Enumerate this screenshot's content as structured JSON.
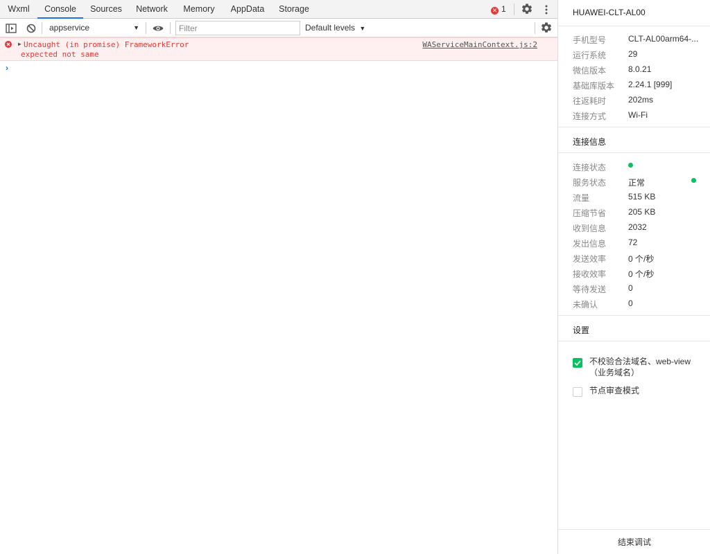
{
  "tabs": [
    {
      "label": "Wxml"
    },
    {
      "label": "Console"
    },
    {
      "label": "Sources"
    },
    {
      "label": "Network"
    },
    {
      "label": "Memory"
    },
    {
      "label": "AppData"
    },
    {
      "label": "Storage"
    }
  ],
  "active_tab": "Console",
  "error_count": "1",
  "console_toolbar": {
    "context": "appservice",
    "filter_placeholder": "Filter",
    "levels": "Default levels"
  },
  "messages": [
    {
      "level": "error",
      "line1": "Uncaught (in promise) FrameworkError",
      "line2": "expected not same",
      "source": "WAServiceMainContext.js:2"
    }
  ],
  "device": {
    "name": "HUAWEI-CLT-AL00",
    "info": [
      {
        "label": "手机型号",
        "value": "CLT-AL00arm64-..."
      },
      {
        "label": "运行系统",
        "value": "29"
      },
      {
        "label": "微信版本",
        "value": "8.0.21"
      },
      {
        "label": "基础库版本",
        "value": "2.24.1 [999]"
      },
      {
        "label": "往返耗时",
        "value": "202ms"
      },
      {
        "label": "连接方式",
        "value": "Wi-Fi"
      }
    ]
  },
  "connection": {
    "title": "连接信息",
    "rows": [
      {
        "label": "连接状态",
        "value": ""
      },
      {
        "label": "服务状态",
        "value": "正常"
      },
      {
        "label": "流量",
        "value": "515 KB"
      },
      {
        "label": "压缩节省",
        "value": "205 KB"
      },
      {
        "label": "收到信息",
        "value": "2032"
      },
      {
        "label": "发出信息",
        "value": "72"
      },
      {
        "label": "发送效率",
        "value": "0 个/秒"
      },
      {
        "label": "接收效率",
        "value": "0 个/秒"
      },
      {
        "label": "等待发送",
        "value": "0"
      },
      {
        "label": "未确认",
        "value": "0"
      }
    ],
    "status_color": "#07c160"
  },
  "settings": {
    "title": "设置",
    "options": [
      {
        "label": "不校验合法域名、web-view（业务域名）",
        "checked": true
      },
      {
        "label": "节点审查模式",
        "checked": false
      }
    ]
  },
  "end_button": "结束调试",
  "colors": {
    "accent": "#1a73e8",
    "error": "#e53935",
    "success": "#07c160"
  }
}
